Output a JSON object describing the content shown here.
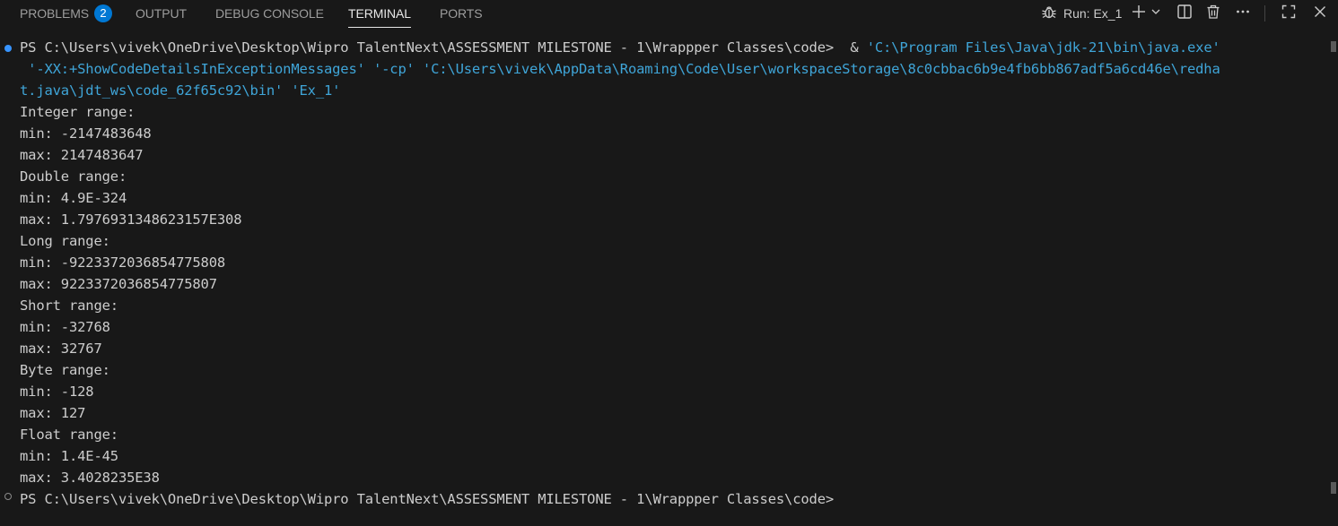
{
  "tabs": [
    {
      "label": "PROBLEMS",
      "badge": "2"
    },
    {
      "label": "OUTPUT"
    },
    {
      "label": "DEBUG CONSOLE"
    },
    {
      "label": "TERMINAL"
    },
    {
      "label": "PORTS"
    }
  ],
  "toolbar": {
    "run_label": "Run: Ex_1",
    "icons": [
      "debug-icon",
      "add-icon",
      "chevron-down-icon",
      "split-icon",
      "trash-icon",
      "more-icon",
      "maximize-icon",
      "close-icon"
    ]
  },
  "terminal": {
    "command_prompt": "PS C:\\Users\\vivek\\OneDrive\\Desktop\\Wipro TalentNext\\ASSESSMENT MILESTONE - 1\\Wrappper Classes\\code> ",
    "command_amp": " & ",
    "command_line1_arg": "'C:\\Program Files\\Java\\jdk-21\\bin\\java.exe'",
    "command_line2": " '-XX:+ShowCodeDetailsInExceptionMessages' '-cp' 'C:\\Users\\vivek\\AppData\\Roaming\\Code\\User\\workspaceStorage\\8c0cbbac6b9e4fb6bb867adf5a6cd46e\\redha",
    "command_line3": "t.java\\jdt_ws\\code_62f65c92\\bin' 'Ex_1'",
    "output": [
      "Integer range:",
      "min: -2147483648",
      "max: 2147483647",
      "Double range:",
      "min: 4.9E-324",
      "max: 1.7976931348623157E308",
      "Long range:",
      "min: -9223372036854775808",
      "max: 9223372036854775807",
      "Short range:",
      "min: -32768",
      "max: 32767",
      "Byte range:",
      "min: -128",
      "max: 127",
      "Float range:",
      "min: 1.4E-45",
      "max: 3.4028235E38"
    ],
    "final_prompt": "PS C:\\Users\\vivek\\OneDrive\\Desktop\\Wipro TalentNext\\ASSESSMENT MILESTONE - 1\\Wrappper Classes\\code>"
  },
  "colors": {
    "background": "#181818",
    "text": "#cccccc",
    "string": "#3fa5d8",
    "badge": "#0078d4",
    "success_dot": "#3794ff"
  }
}
